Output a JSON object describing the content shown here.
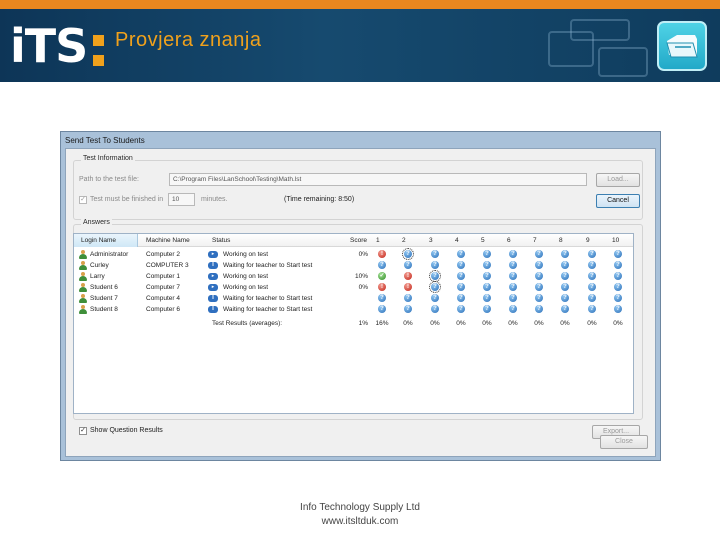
{
  "header": {
    "logo_main": "iTS",
    "logo_colon": ":",
    "title": "Provjera znanja",
    "icon": "folder-app-icon",
    "accent_color": "#e9871f",
    "banner_color": "#0f3c5d"
  },
  "dialog": {
    "title": "Send Test To Students",
    "test_info": {
      "legend": "Test Information",
      "path_label": "Path to the test file:",
      "path_value": "C:\\Program Files\\LanSchool\\Testing\\Math.lst",
      "load_label": "Load...",
      "time_check_label": "Test must be finished in",
      "time_value": "10",
      "minutes_label": "minutes.",
      "time_remaining": "(Time remaining: 8:50)",
      "cancel_label": "Cancel"
    },
    "answers": {
      "legend": "Answers",
      "columns": [
        "Login Name",
        "Machine Name",
        "Status",
        "Score",
        "1",
        "2",
        "3",
        "4",
        "5",
        "6",
        "7",
        "8",
        "9",
        "10"
      ],
      "rows": [
        {
          "login": "Administrator",
          "machine": "Computer 2",
          "status": "Working on test",
          "score": "0%",
          "answers": [
            "x",
            "sq",
            "q",
            "q",
            "q",
            "q",
            "q",
            "q",
            "q",
            "q"
          ]
        },
        {
          "login": "Curley",
          "machine": "COMPUTER 3",
          "status": "Waiting for teacher to Start test",
          "score": "",
          "answers": [
            "q",
            "q",
            "q",
            "q",
            "q",
            "q",
            "q",
            "q",
            "q",
            "q"
          ]
        },
        {
          "login": "Larry",
          "machine": "Computer 1",
          "status": "Working on test",
          "score": "10%",
          "answers": [
            "c",
            "x",
            "sq",
            "q",
            "q",
            "q",
            "q",
            "q",
            "q",
            "q"
          ]
        },
        {
          "login": "Student 6",
          "machine": "Computer 7",
          "status": "Working on test",
          "score": "0%",
          "answers": [
            "x",
            "x",
            "sq",
            "q",
            "q",
            "q",
            "q",
            "q",
            "q",
            "q"
          ]
        },
        {
          "login": "Student 7",
          "machine": "Computer 4",
          "status": "Waiting for teacher to Start test",
          "score": "",
          "answers": [
            "q",
            "q",
            "q",
            "q",
            "q",
            "q",
            "q",
            "q",
            "q",
            "q"
          ]
        },
        {
          "login": "Student 8",
          "machine": "Computer 6",
          "status": "Waiting for teacher to Start test",
          "score": "",
          "answers": [
            "q",
            "q",
            "q",
            "q",
            "q",
            "q",
            "q",
            "q",
            "q",
            "q"
          ]
        }
      ],
      "averages_label": "Test Results (averages):",
      "averages_score": "1%",
      "averages": [
        "16%",
        "0%",
        "0%",
        "0%",
        "0%",
        "0%",
        "0%",
        "0%",
        "0%",
        "0%"
      ]
    },
    "show_results_label": "Show Question Results",
    "export_label": "Export...",
    "close_label": "Close"
  },
  "footer": {
    "company": "Info Technology Supply Ltd",
    "website": "www.itsltduk.com"
  }
}
